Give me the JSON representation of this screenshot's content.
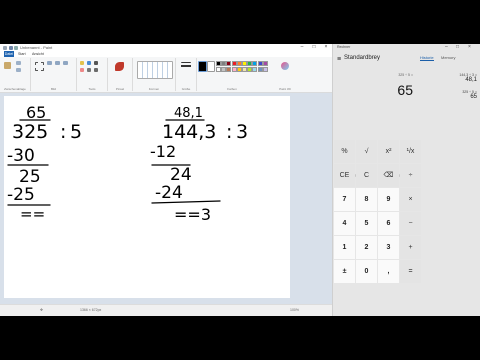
{
  "paint": {
    "title": "Unbenannt - Paint",
    "menu": {
      "file": "Datei",
      "start": "Start",
      "view": "Ansicht"
    },
    "groups": [
      "Zwischenablage",
      "Bild",
      "Tools",
      "Pinsel",
      "Formen",
      "Größe",
      "Farben",
      "Paint 3D"
    ],
    "palette": [
      "#000000",
      "#7f7f7f",
      "#880015",
      "#ed1c24",
      "#ff7f27",
      "#fff200",
      "#22b14c",
      "#00a2e8",
      "#3f48cc",
      "#a349a4",
      "#ffffff",
      "#c3c3c3",
      "#b97a57",
      "#ffaec9",
      "#ffc90e",
      "#efe4b0",
      "#b5e61d",
      "#99d9ea",
      "#7092be",
      "#c8bfe7"
    ],
    "status": {
      "zoom": "100%",
      "size": "1366 × 672px"
    }
  },
  "math": {
    "left": {
      "quotient": "65",
      "dividend": "325",
      "sep": ":",
      "divisor": "5",
      "sub1": "-30",
      "rem1": "25",
      "sub2": "-25",
      "rem2": "=="
    },
    "right": {
      "quotient": "48,1",
      "dividend": "144,3",
      "sep": ":",
      "divisor": "3",
      "sub1": "-12",
      "rem1": "24",
      "sub2": "-24",
      "rem2": "==3"
    }
  },
  "calculator": {
    "title": "Rechner",
    "mode": "Standardbrey",
    "tabs": [
      "Historie",
      "Memory"
    ],
    "expression": "325 ÷ 5 =",
    "display": "65",
    "history": [
      {
        "expr": "144,3 ÷ 3 =",
        "result": "48,1"
      },
      {
        "expr": "325 ÷ 5 =",
        "result": "65"
      }
    ],
    "memory_keys": [
      "MC",
      "MR",
      "M+",
      "M-",
      "MS"
    ],
    "keys": [
      "%",
      "√",
      "x²",
      "¹/x",
      "CE",
      "C",
      "⌫",
      "÷",
      "7",
      "8",
      "9",
      "×",
      "4",
      "5",
      "6",
      "−",
      "1",
      "2",
      "3",
      "+",
      "±",
      "0",
      ",",
      "="
    ]
  }
}
